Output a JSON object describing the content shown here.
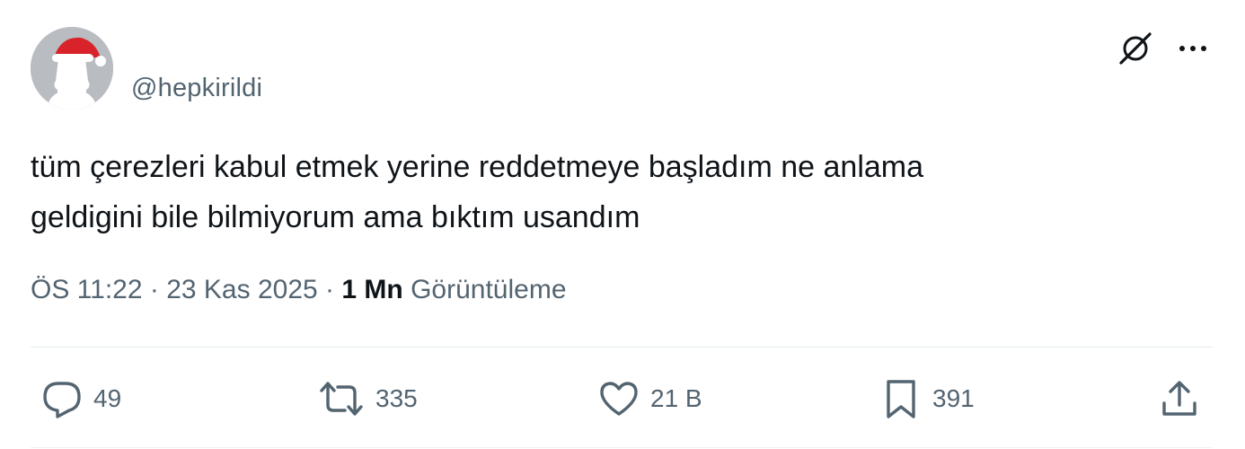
{
  "tweet": {
    "author_handle": "@hepkirildi",
    "text_lines": [
      "tüm çerezleri kabul etmek yerine reddetmeye başladım ne anlama",
      "geldigini bile bilmiyorum ama bıktım usandım"
    ],
    "time": "ÖS 11:22",
    "separator": "·",
    "date": "23 Kas 2025",
    "views_count": "1 Mn",
    "views_label": "Görüntüleme"
  },
  "actions": {
    "replies": "49",
    "reposts": "335",
    "likes": "21 B",
    "bookmarks": "391"
  },
  "icons": {
    "avatar": "default-avatar-with-santa-hat",
    "grok": "grok-icon",
    "more": "more-options-icon",
    "reply": "reply-icon",
    "repost": "repost-icon",
    "like": "heart-icon",
    "bookmark": "bookmark-icon",
    "share": "share-icon"
  },
  "colors": {
    "text": "#0f1419",
    "secondary": "#536471",
    "divider": "#e6ecf0",
    "avatar_bg": "#b9bcc1",
    "santa_red": "#d8232a"
  }
}
